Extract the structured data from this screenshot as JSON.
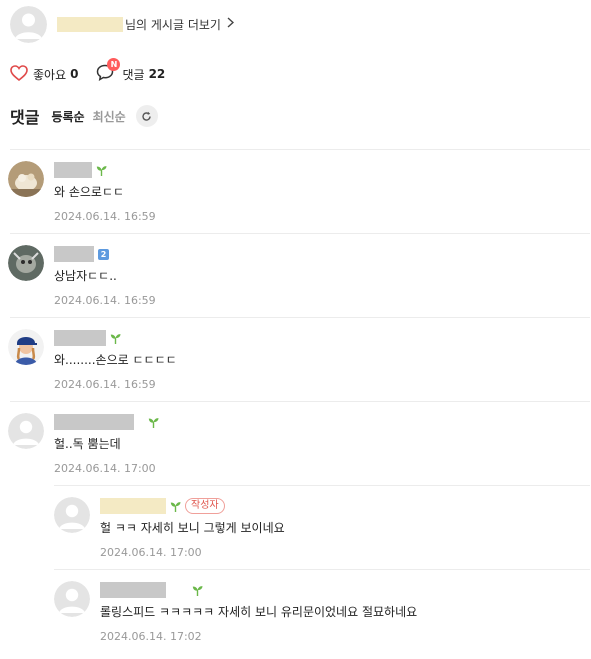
{
  "author_bar": {
    "more_text": "님의 게시글 더보기"
  },
  "actions": {
    "like_label": "좋아요",
    "like_count": "0",
    "comment_label": "댓글",
    "comment_count": "22",
    "new_badge": "N"
  },
  "comment_section": {
    "title": "댓글",
    "sort_registration": "등록순",
    "sort_latest": "최신순"
  },
  "comments": [
    {
      "text": "와 손으로ㄷㄷ",
      "date": "2024.06.14. 16:59"
    },
    {
      "text": "상남자ㄷㄷ..",
      "date": "2024.06.14. 16:59",
      "level_badge": "2"
    },
    {
      "text": "와........손으로 ㄷㄷㄷㄷ",
      "date": "2024.06.14. 16:59"
    },
    {
      "text": "헐..독 뿜는데",
      "date": "2024.06.14. 17:00"
    },
    {
      "text": "헐 ㅋㅋ 자세히 보니 그렇게 보이네요",
      "date": "2024.06.14. 17:00",
      "writer_badge": "작성자"
    },
    {
      "text": "롤링스피드 ㅋㅋㅋㅋㅋ 자세히 보니 유리문이었네요 절묘하네요",
      "date": "2024.06.14. 17:02"
    }
  ],
  "colors": {
    "sprout": "#6bb84a",
    "writer_badge": "#e0584f",
    "new_badge": "#ff5b5b",
    "heart": "#e04a4a",
    "level_badge": "#5d9adf"
  }
}
